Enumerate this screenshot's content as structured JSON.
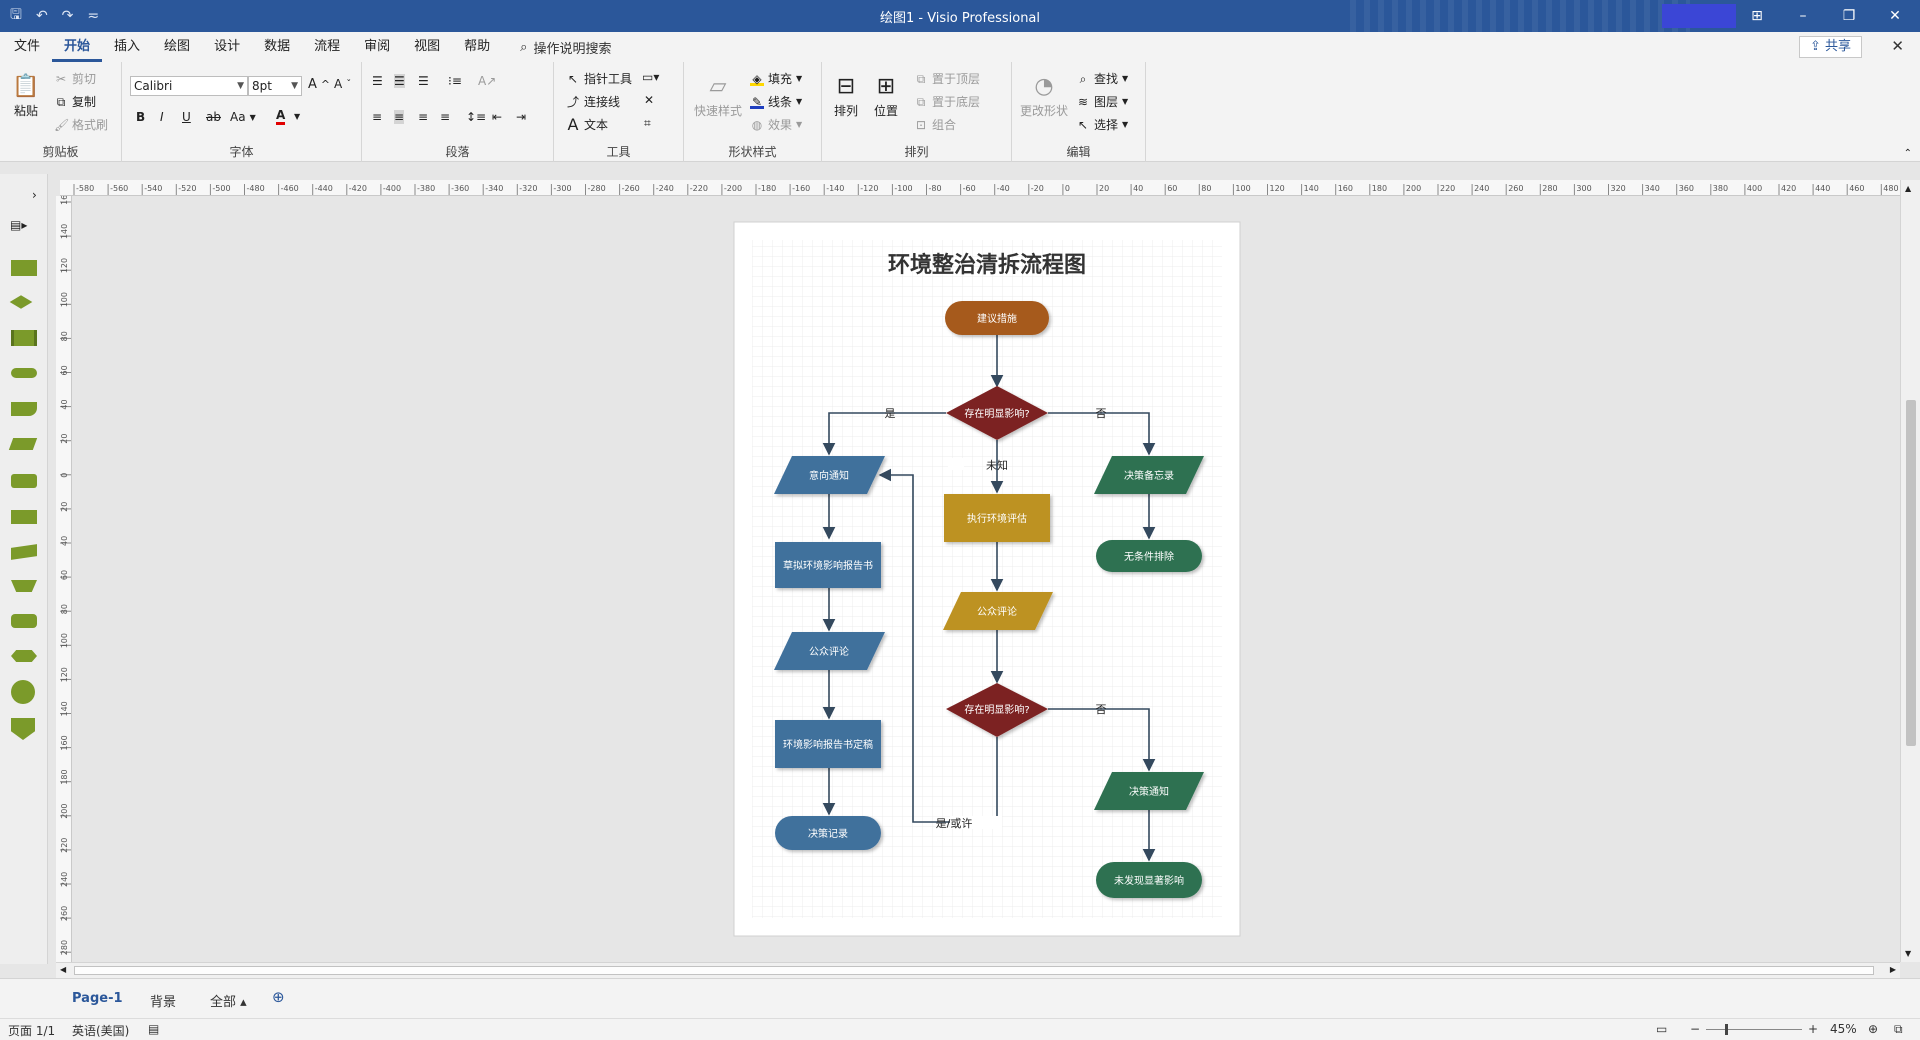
{
  "window": {
    "title": "绘图1  -  Visio Professional",
    "controls": {
      "ribbon_display": "⊞",
      "minimize": "–",
      "restore": "❐",
      "close": "✕"
    }
  },
  "qat": {
    "save": "🖫",
    "undo": "↶",
    "redo": "↷",
    "customize": "≂"
  },
  "menu": {
    "tabs": [
      "文件",
      "开始",
      "插入",
      "绘图",
      "设计",
      "数据",
      "流程",
      "审阅",
      "视图",
      "帮助"
    ],
    "active": "开始",
    "search_label": "操作说明搜索",
    "share": "共享"
  },
  "ribbon": {
    "clipboard": {
      "label": "剪贴板",
      "paste": "粘贴",
      "cut": "剪切",
      "copy": "复制",
      "format_painter": "格式刷"
    },
    "font": {
      "label": "字体",
      "family": "Calibri",
      "size": "8pt",
      "bold": "B",
      "italic": "I",
      "underline": "U",
      "strike": "ab",
      "case": "Aa",
      "color": "A"
    },
    "paragraph": {
      "label": "段落"
    },
    "tools": {
      "label": "工具",
      "pointer": "指针工具",
      "connector": "连接线",
      "text": "文本"
    },
    "shape_styles": {
      "label": "形状样式",
      "quick_styles": "快速样式",
      "fill": "填充",
      "line": "线条",
      "effects": "效果"
    },
    "arrange": {
      "label": "排列",
      "align": "排列",
      "position": "位置",
      "bring_front": "置于顶层",
      "send_back": "置于底层",
      "group": "组合"
    },
    "editing": {
      "label": "编辑",
      "change_shape": "更改形状",
      "find": "查找",
      "layers": "图层",
      "select": "选择"
    }
  },
  "ruler": {
    "h_ticks": [
      "-580",
      "-560",
      "-540",
      "-520",
      "-500",
      "-480",
      "-460",
      "-440",
      "-420",
      "-400",
      "-380",
      "-360",
      "-340",
      "-320",
      "-300",
      "-280",
      "-260",
      "-240",
      "-220",
      "-200",
      "-180",
      "-160",
      "-140",
      "-120",
      "-100",
      "-80",
      "-60",
      "-40",
      "-20",
      "0",
      "20",
      "40",
      "60",
      "80",
      "100",
      "120",
      "140",
      "160",
      "180",
      "200",
      "220",
      "240",
      "260",
      "280",
      "300",
      "320",
      "340",
      "360",
      "380",
      "400",
      "420",
      "440",
      "460",
      "480"
    ],
    "v_ticks": [
      "160",
      "140",
      "120",
      "100",
      "80",
      "60",
      "40",
      "20",
      "0",
      "20",
      "40",
      "60",
      "80",
      "100",
      "120",
      "140",
      "160",
      "180",
      "200",
      "220",
      "240",
      "260",
      "280"
    ]
  },
  "diagram": {
    "title": "环境整治清拆流程图",
    "nodes": {
      "start": "建议措施",
      "decision1": "存在明显影响?",
      "notice": "意向通知",
      "draft": "草拟环境影响报告书",
      "comment_left": "公众评论",
      "finalize": "环境影响报告书定稿",
      "record": "决策记录",
      "assess": "执行环境评估",
      "comment_mid": "公众评论",
      "decision2": "存在明显影响?",
      "memo": "决策备忘录",
      "excluded": "无条件排除",
      "decision_notice": "决策通知",
      "no_impact": "未发现显著影响"
    },
    "edge_labels": {
      "yes": "是",
      "no": "否",
      "unknown": "未知",
      "no2": "否",
      "maybe": "是/或许"
    },
    "colors": {
      "orange": "#a65a1e",
      "maroon": "#7b2424",
      "blue": "#41719c",
      "gold": "#bd9224",
      "green": "#2e7151"
    }
  },
  "pages": {
    "tabs": [
      "Page-1",
      "背景",
      "全部 ▴"
    ],
    "active": "Page-1"
  },
  "status": {
    "page": "页面 1/1",
    "language": "英语(美国)",
    "zoom": "45%"
  }
}
